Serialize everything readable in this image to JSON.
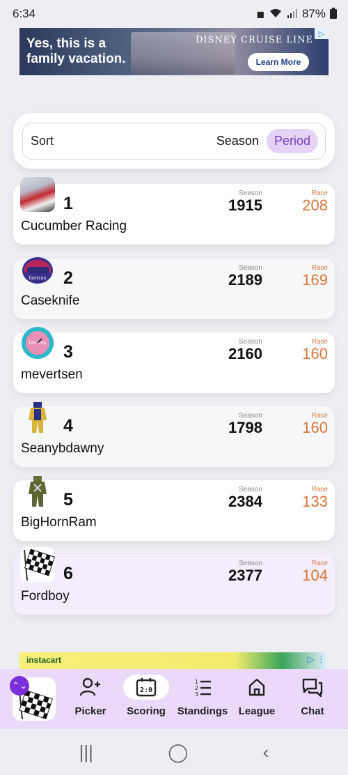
{
  "status_bar": {
    "time": "6:34",
    "battery": "87%"
  },
  "ad_top": {
    "headline": "Yes, this is a family vacation.",
    "brand": "DISNEY CRUISE LINE",
    "cta": "Learn More",
    "choice": "▷"
  },
  "sort": {
    "label": "Sort",
    "options": [
      "Season",
      "Period"
    ],
    "active": "Period"
  },
  "stat_labels": {
    "season": "Season",
    "race": "Race"
  },
  "teams": [
    {
      "rank": "1",
      "name": "Cucumber Racing",
      "season": "1915",
      "race": "208",
      "avatar": "driver-photo"
    },
    {
      "rank": "2",
      "name": "Caseknife",
      "season": "2189",
      "race": "169",
      "avatar": "helmet-icon"
    },
    {
      "rank": "3",
      "name": "mevertsen",
      "season": "2160",
      "race": "160",
      "avatar": "steering-wheel-icon"
    },
    {
      "rank": "4",
      "name": "Seanybdawny",
      "season": "1798",
      "race": "160",
      "avatar": "firesuit-yellow-icon"
    },
    {
      "rank": "5",
      "name": "BigHornRam",
      "season": "2384",
      "race": "133",
      "avatar": "firesuit-green-icon"
    },
    {
      "rank": "6",
      "name": "Fordboy",
      "season": "2377",
      "race": "104",
      "avatar": "checkered-flag-icon"
    }
  ],
  "ad_bottom": {
    "brand": "instacart",
    "choice": "▷ ⋮"
  },
  "bottom_nav": {
    "items": [
      {
        "label": "Picker",
        "icon": "add-user-icon"
      },
      {
        "label": "Scoring",
        "icon": "scoreboard-icon"
      },
      {
        "label": "Standings",
        "icon": "numbered-list-icon"
      },
      {
        "label": "League",
        "icon": "home-icon"
      },
      {
        "label": "Chat",
        "icon": "chat-icon"
      }
    ],
    "active": "Scoring",
    "switch_badge": "⌃⌄"
  },
  "android_nav": {
    "recents": "|||",
    "home": "◯",
    "back": "‹"
  },
  "colors": {
    "accent": "#7a3fb8",
    "race": "#d8763c",
    "nav_bg": "#ead9f8"
  }
}
